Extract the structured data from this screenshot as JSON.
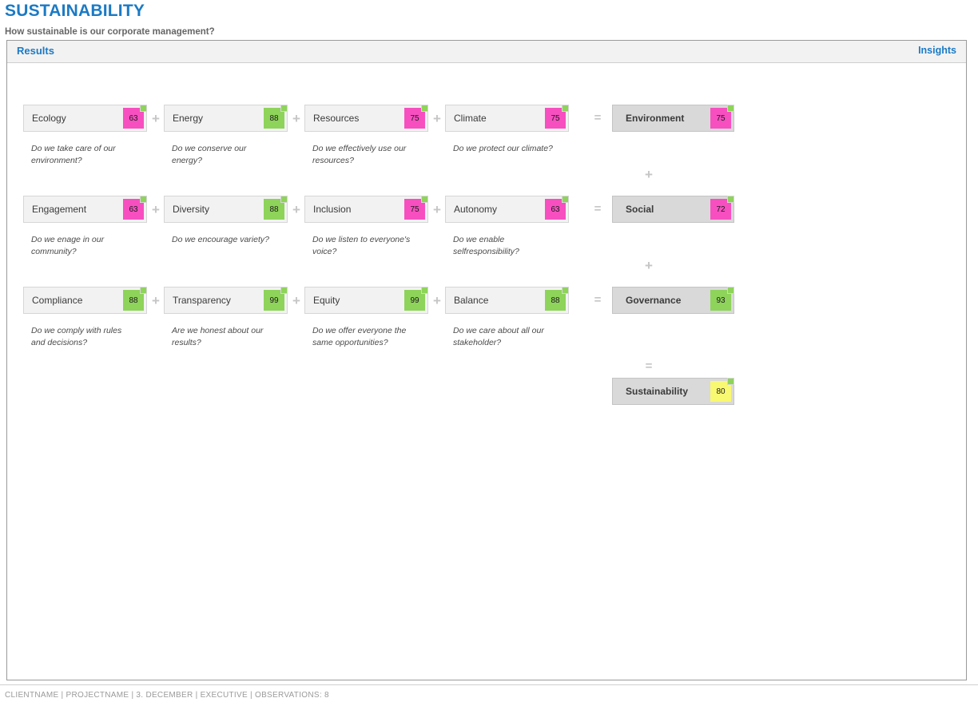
{
  "header": {
    "title": "SUSTAINABILITY",
    "subtitle": "How sustainable is our corporate management?"
  },
  "panel": {
    "tab_results": "Results",
    "link_insights": "Insights"
  },
  "colors": {
    "accent_blue": "#1b7ac4",
    "badge_pink": "#f74fc0",
    "badge_green": "#8ed35a",
    "badge_yellow": "#f9f871",
    "card_bg": "#f2f2f2",
    "summary_bg": "#d9d9d9",
    "operator_gray": "#c6c6c6"
  },
  "operators": {
    "plus": "+",
    "equals": "="
  },
  "rows": [
    {
      "criteria": [
        {
          "label": "Ecology",
          "score": "63",
          "color": "#f74fc0",
          "question": "Do we take care of our environment?"
        },
        {
          "label": "Energy",
          "score": "88",
          "color": "#8ed35a",
          "question": "Do we conserve our energy?"
        },
        {
          "label": "Resources",
          "score": "75",
          "color": "#f74fc0",
          "question": "Do we effectively use our resources?"
        },
        {
          "label": "Climate",
          "score": "75",
          "color": "#f74fc0",
          "question": "Do we protect our climate?"
        }
      ],
      "summary": {
        "label": "Environment",
        "score": "75",
        "color": "#f74fc0"
      }
    },
    {
      "criteria": [
        {
          "label": "Engagement",
          "score": "63",
          "color": "#f74fc0",
          "question": "Do we enage in our community?"
        },
        {
          "label": "Diversity",
          "score": "88",
          "color": "#8ed35a",
          "question": "Do we encourage variety?"
        },
        {
          "label": "Inclusion",
          "score": "75",
          "color": "#f74fc0",
          "question": "Do we listen to everyone's voice?"
        },
        {
          "label": "Autonomy",
          "score": "63",
          "color": "#f74fc0",
          "question": "Do we enable selfresponsibility?"
        }
      ],
      "summary": {
        "label": "Social",
        "score": "72",
        "color": "#f74fc0"
      }
    },
    {
      "criteria": [
        {
          "label": "Compliance",
          "score": "88",
          "color": "#8ed35a",
          "question": "Do we comply with rules and decisions?"
        },
        {
          "label": "Transparency",
          "score": "99",
          "color": "#8ed35a",
          "question": "Are we honest about our results?"
        },
        {
          "label": "Equity",
          "score": "99",
          "color": "#8ed35a",
          "question": "Do we offer everyone the same opportunities?"
        },
        {
          "label": "Balance",
          "score": "88",
          "color": "#8ed35a",
          "question": "Do we care about all our stakeholder?"
        }
      ],
      "summary": {
        "label": "Governance",
        "score": "93",
        "color": "#8ed35a"
      }
    }
  ],
  "total": {
    "label": "Sustainability",
    "score": "80",
    "color": "#f9f871"
  },
  "footer": {
    "text": "CLIENTNAME | PROJECTNAME | 3. DECEMBER | EXECUTIVE | OBSERVATIONS: 8"
  }
}
